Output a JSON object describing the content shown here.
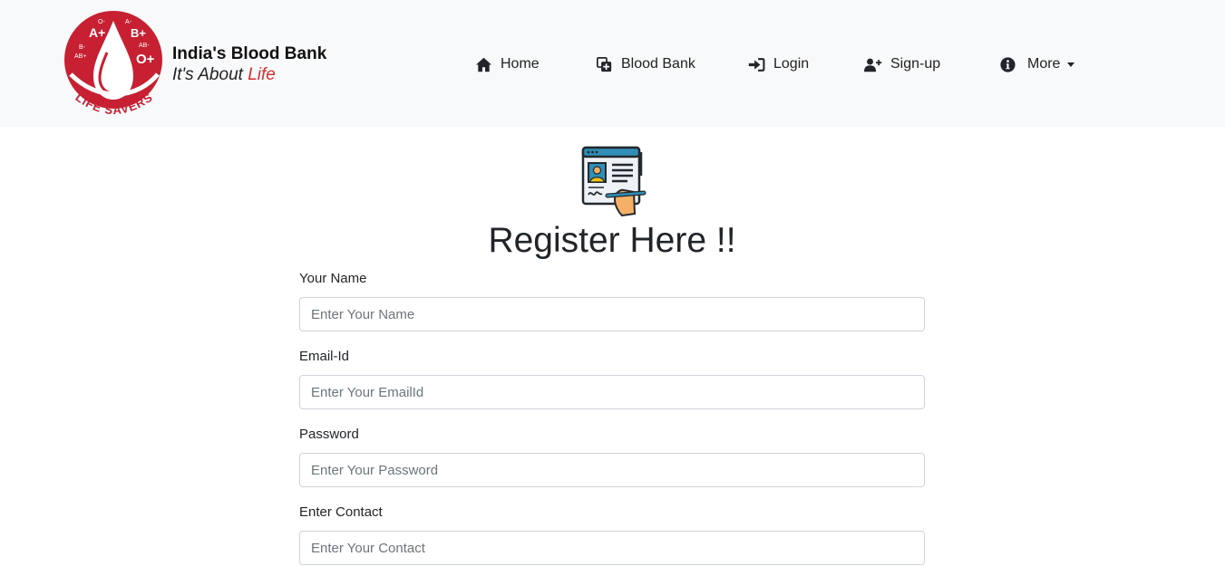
{
  "brand": {
    "title": "India's Blood Bank",
    "tagline_prefix": "It's About ",
    "tagline_accent": "Life",
    "logo_text": "LIFE SAVERS",
    "logo_groups": [
      "A+",
      "B+",
      "O+",
      "A-",
      "O-",
      "B-",
      "AB-",
      "AB+"
    ],
    "accent_color": "#d32f2f",
    "logo_color": "#c62032"
  },
  "nav": {
    "items": [
      {
        "label": "Home",
        "icon": "home-icon"
      },
      {
        "label": "Blood Bank",
        "icon": "add-box-icon"
      },
      {
        "label": "Login",
        "icon": "sign-in-icon"
      },
      {
        "label": "Sign-up",
        "icon": "user-plus-icon"
      },
      {
        "label": "More",
        "icon": "info-circle-icon"
      }
    ]
  },
  "form": {
    "icon": "registration-form-icon",
    "title": "Register Here !!",
    "fields": [
      {
        "label": "Your Name",
        "placeholder": "Enter Your Name",
        "value": ""
      },
      {
        "label": "Email-Id",
        "placeholder": "Enter Your EmailId",
        "value": ""
      },
      {
        "label": "Password",
        "placeholder": "Enter Your Password",
        "value": ""
      },
      {
        "label": "Enter Contact",
        "placeholder": "Enter Your Contact",
        "value": ""
      }
    ]
  }
}
